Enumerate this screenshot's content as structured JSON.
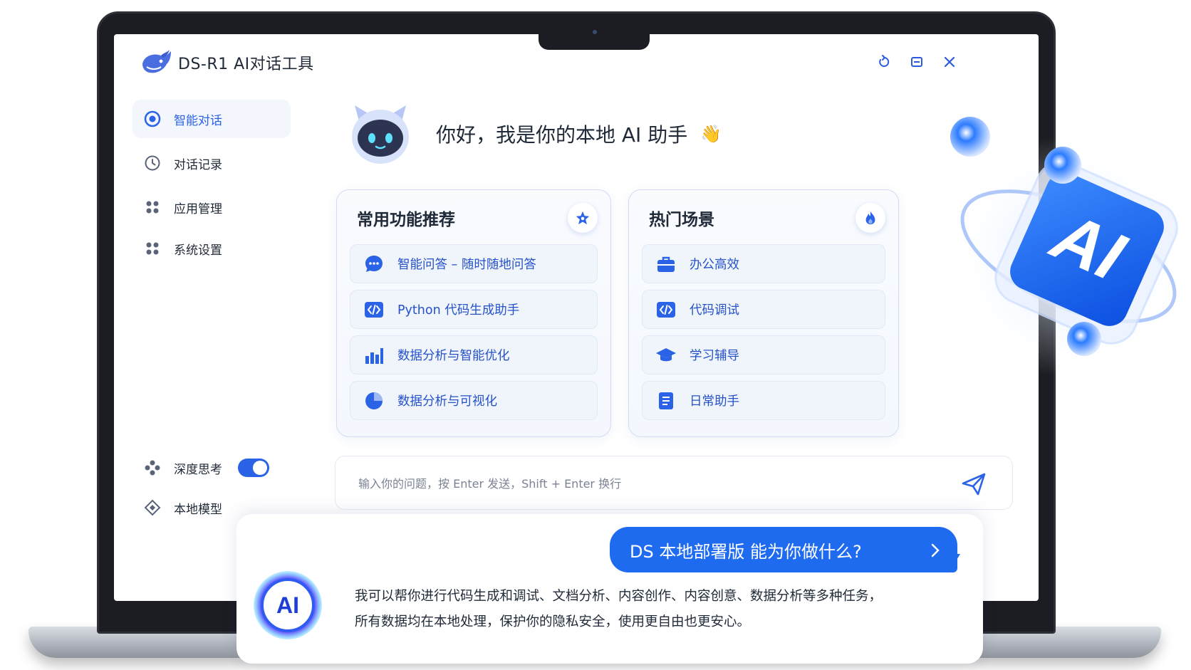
{
  "app": {
    "title": "DS-R1 AI对话工具"
  },
  "window_controls": [
    "refresh-icon",
    "minimize-icon",
    "close-icon"
  ],
  "sidebar": {
    "items": [
      {
        "label": "智能对话",
        "icon": "target-icon",
        "active": true
      },
      {
        "label": "对话记录",
        "icon": "clock-icon",
        "active": false
      },
      {
        "label": "应用管理",
        "icon": "apps-icon",
        "active": false
      },
      {
        "label": "系统设置",
        "icon": "settings-icon",
        "active": false
      }
    ],
    "bottom": {
      "deep_think": {
        "label": "深度思考",
        "enabled": true
      },
      "local_model": {
        "label": "本地模型"
      }
    }
  },
  "greeting": {
    "text": "你好，我是你的本地 AI 助手",
    "emoji": "👋"
  },
  "cards": [
    {
      "title": "常用功能推荐",
      "badge_icon": "star-icon",
      "items": [
        {
          "label": "智能问答 – 随时随地问答",
          "icon": "chat-bubble-icon"
        },
        {
          "label": "Python 代码生成助手",
          "icon": "code-icon"
        },
        {
          "label": "数据分析与智能优化",
          "icon": "bar-chart-icon"
        },
        {
          "label": "数据分析与可视化",
          "icon": "pie-chart-icon"
        }
      ]
    },
    {
      "title": "热门场景",
      "badge_icon": "flame-icon",
      "items": [
        {
          "label": "办公高效",
          "icon": "briefcase-icon"
        },
        {
          "label": "代码调试",
          "icon": "code-icon"
        },
        {
          "label": "学习辅导",
          "icon": "graduation-cap-icon"
        },
        {
          "label": "日常助手",
          "icon": "document-icon"
        }
      ]
    }
  ],
  "input": {
    "placeholder": "输入你的问题，按 Enter 发送，Shift + Enter 换行"
  },
  "info": {
    "bubble": "DS 本地部署版  能为你做什么?",
    "line1": "我可以帮你进行代码生成和调试、文档分析、内容创作、内容创意、数据分析等多种任务，",
    "line2": "所有数据均在本地处理，保护你的隐私安全，使用更自由也更安心。",
    "badge_text": "AI"
  },
  "decoration": {
    "text": "AI"
  },
  "colors": {
    "accent": "#2b63e6",
    "bubble": "#1f6bf0",
    "text": "#1f2937"
  }
}
